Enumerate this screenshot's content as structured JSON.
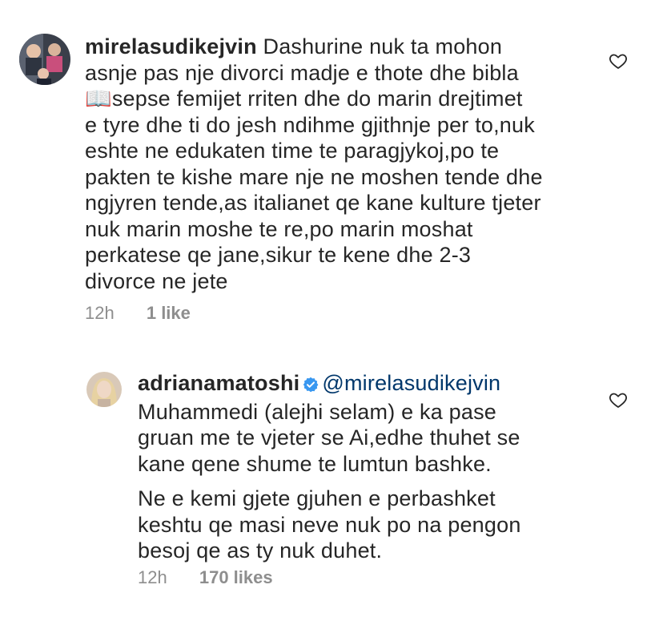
{
  "comments": [
    {
      "username": "mirelasudikejvin",
      "lines": [
        "Dashurine nuk ta mohon",
        "asnje pas nje divorci madje e thote dhe bibla",
        "📖sepse femijet rriten dhe do marin drejtimet",
        "e tyre dhe ti do jesh ndihme gjithnje per to,nuk",
        "eshte ne edukaten time te paragjykoj,po te",
        "pakten te kishe mare nje ne moshen tende dhe",
        "ngjyren tende,as italianet qe kane kulture tjeter",
        "nuk marin moshe te re,po marin moshat",
        "perkatese qe jane,sikur te kene dhe 2-3",
        "divorce ne jete"
      ],
      "time": "12h",
      "likes": "1 like",
      "icons": {
        "like": "heart-outline-icon"
      }
    },
    {
      "username": "adrianamatoshi",
      "verified": true,
      "mention": "@mirelasudikejvin",
      "paragraph1": [
        "Muhammedi (alejhi selam) e ka pase",
        "gruan me te vjeter se Ai,edhe thuhet se",
        "kane qene shume te lumtun bashke."
      ],
      "paragraph2": [
        "Ne e kemi gjete gjuhen e perbashket",
        "keshtu qe masi neve nuk po na pengon",
        "besoj qe as ty nuk duhet."
      ],
      "time": "12h",
      "likes": "170 likes",
      "icons": {
        "verified": "verified-badge-icon",
        "like": "heart-outline-icon"
      }
    }
  ],
  "colors": {
    "text": "#262626",
    "meta": "#8e8e8e",
    "mention": "#00376b",
    "verified": "#3897f0"
  }
}
